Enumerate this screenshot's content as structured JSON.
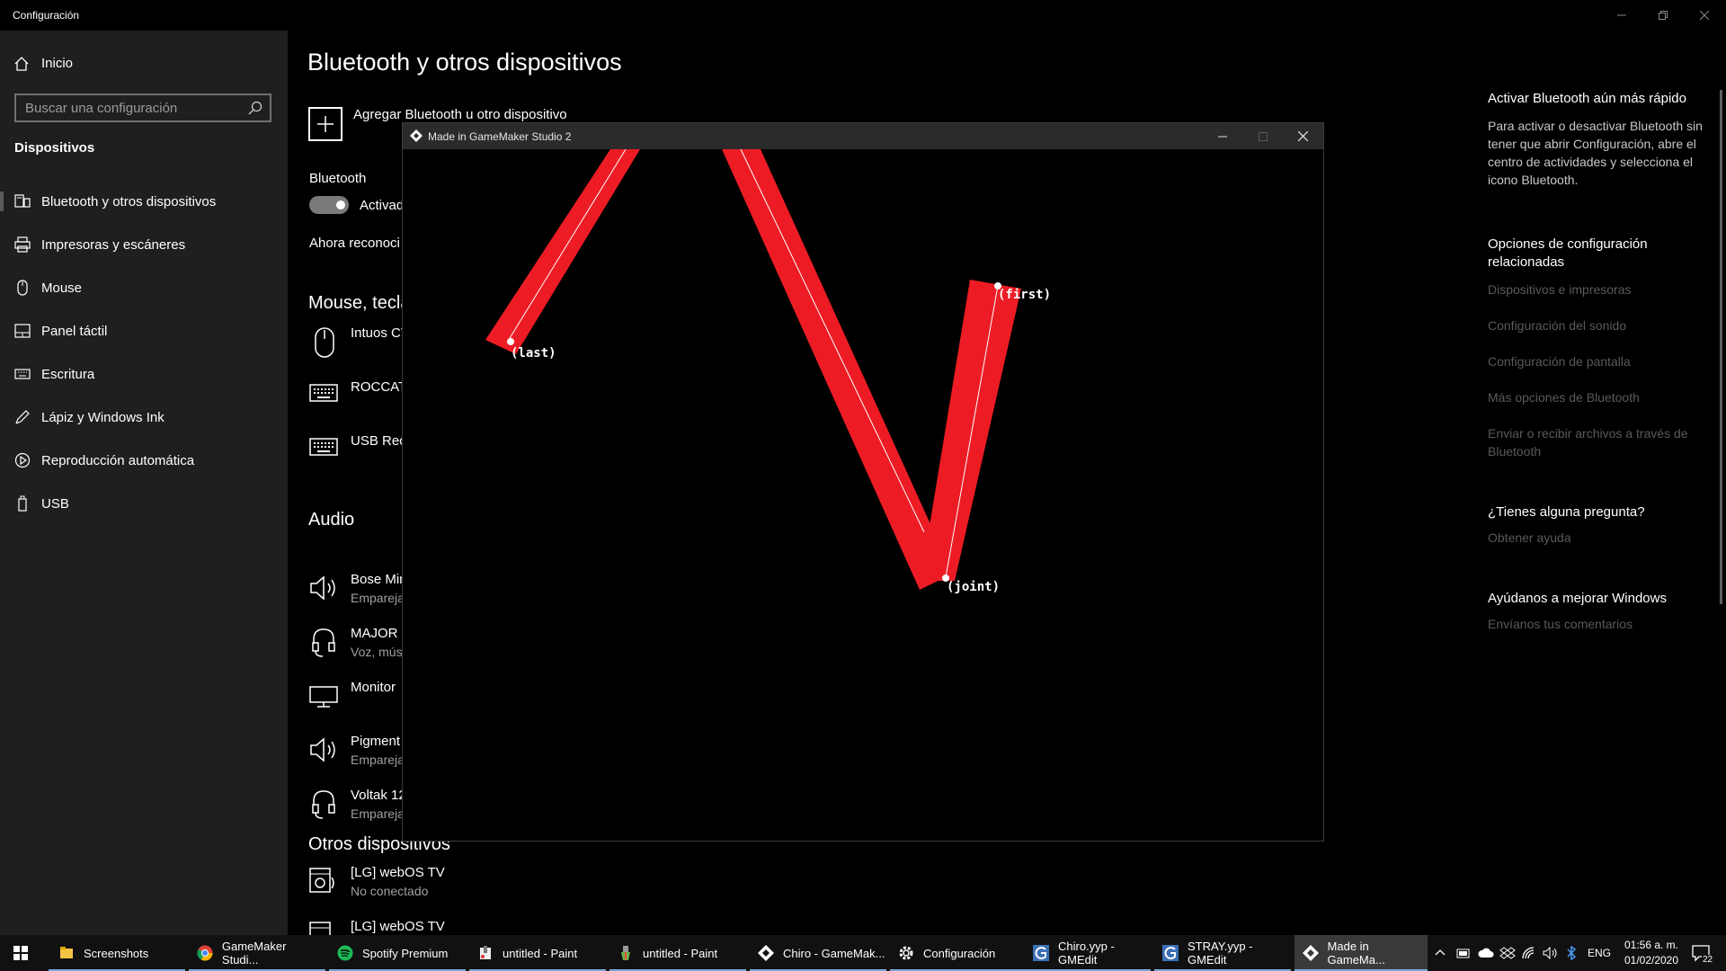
{
  "settings": {
    "title": "Configuración",
    "sidebar": {
      "home": "Inicio",
      "search_placeholder": "Buscar una configuración",
      "section": "Dispositivos",
      "items": [
        {
          "label": "Bluetooth y otros dispositivos",
          "icon": "bluetooth-devices-icon"
        },
        {
          "label": "Impresoras y escáneres",
          "icon": "printer-icon"
        },
        {
          "label": "Mouse",
          "icon": "mouse-icon"
        },
        {
          "label": "Panel táctil",
          "icon": "touchpad-icon"
        },
        {
          "label": "Escritura",
          "icon": "keyboard-icon"
        },
        {
          "label": "Lápiz y Windows Ink",
          "icon": "pen-icon"
        },
        {
          "label": "Reproducción automática",
          "icon": "autoplay-icon"
        },
        {
          "label": "USB",
          "icon": "usb-icon"
        }
      ]
    },
    "main": {
      "page_title": "Bluetooth y otros dispositivos",
      "add_device": "Agregar Bluetooth u otro dispositivo",
      "bluetooth_label": "Bluetooth",
      "bluetooth_state": "Activad",
      "discoverable_text": "Ahora reconoci",
      "mouse_section": "Mouse, tecla",
      "mouse_devices": [
        {
          "name": "Intuos CT",
          "icon": "mouse-icon"
        },
        {
          "name": "ROCCAT",
          "icon": "keyboard-icon"
        },
        {
          "name": "USB Rece",
          "icon": "keyboard-icon"
        }
      ],
      "audio_section": "Audio",
      "audio_devices": [
        {
          "name": "Bose Min",
          "status": "Empareja",
          "icon": "speaker-icon"
        },
        {
          "name": "MAJOR I",
          "status": "Voz, mús",
          "icon": "headset-icon"
        },
        {
          "name": "Monitor",
          "status": "",
          "icon": "monitor-icon"
        },
        {
          "name": "Pigment",
          "status": "Empareja",
          "icon": "speaker-icon"
        },
        {
          "name": "Voltak 12",
          "status": "Empareja",
          "icon": "headset-icon"
        }
      ],
      "other_section": "Otros dispositivos",
      "other_devices": [
        {
          "name": "[LG] webOS TV",
          "status": "No conectado",
          "icon": "media-device-icon"
        },
        {
          "name": "[LG] webOS TV",
          "status": "",
          "icon": "media-device-icon"
        }
      ]
    },
    "right_panel": {
      "tip_title": "Activar Bluetooth aún más rápido",
      "tip_body": "Para activar o desactivar Bluetooth sin tener que abrir Configuración, abre el centro de actividades y selecciona el icono Bluetooth.",
      "related_title": "Opciones de configuración relacionadas",
      "related_links": [
        "Dispositivos e impresoras",
        "Configuración del sonido",
        "Configuración de pantalla",
        "Más opciones de Bluetooth",
        "Enviar o recibir archivos a través de Bluetooth"
      ],
      "question_title": "¿Tienes alguna pregunta?",
      "question_link": "Obtener ayuda",
      "improve_title": "Ayúdanos a mejorar Windows",
      "improve_link": "Envíanos tus comentarios"
    }
  },
  "gamemaker": {
    "title": "Made in GameMaker Studio 2",
    "labels": {
      "first": "(first)",
      "joint": "(joint)",
      "last": "(last)"
    },
    "colors": {
      "limb": "#ed1c24",
      "bone_line": "#ffffff",
      "joint_dot": "#ffffff"
    }
  },
  "taskbar": {
    "items": [
      {
        "label": "Screenshots",
        "icon": "folder-icon"
      },
      {
        "label": "GameMaker Studi...",
        "icon": "chrome-icon"
      },
      {
        "label": "Spotify Premium",
        "icon": "spotify-icon"
      },
      {
        "label": "untitled - Paint",
        "icon": "paint-icon"
      },
      {
        "label": "untitled - Paint",
        "icon": "paint-icon"
      },
      {
        "label": "Chiro - GameMak...",
        "icon": "gamemaker-icon"
      },
      {
        "label": "Configuración",
        "icon": "gear-icon"
      },
      {
        "label": "Chiro.yyp - GMEdit",
        "icon": "gmedit-icon"
      },
      {
        "label": "STRAY.yyp - GMEdit",
        "icon": "gmedit-icon"
      },
      {
        "label": "Made in GameMa...",
        "icon": "gamemaker-icon"
      }
    ],
    "tray": {
      "language": "ENG",
      "time": "01:56 a. m.",
      "date": "01/02/2020",
      "notifications": "22"
    }
  }
}
